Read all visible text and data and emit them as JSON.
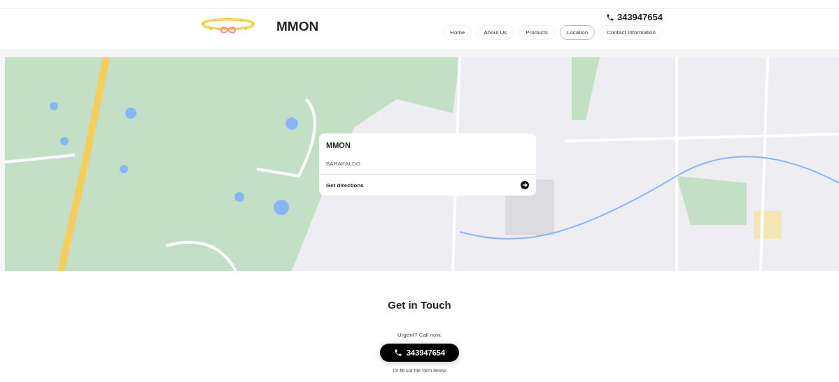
{
  "header": {
    "brand": "MMON",
    "phone": "343947654",
    "nav": [
      {
        "label": "Home",
        "selected": false
      },
      {
        "label": "About Us",
        "selected": false
      },
      {
        "label": "Products",
        "selected": false
      },
      {
        "label": "Location",
        "selected": true
      },
      {
        "label": "Contact Information",
        "selected": false
      }
    ]
  },
  "map": {
    "card": {
      "title": "MMON",
      "address": "BARAKALDO",
      "action": "Get directions"
    }
  },
  "contact": {
    "heading": "Get in Touch",
    "urgent": "Urgent? Call now.",
    "phone": "343947654",
    "form_hint": "Or fill out the form below"
  }
}
